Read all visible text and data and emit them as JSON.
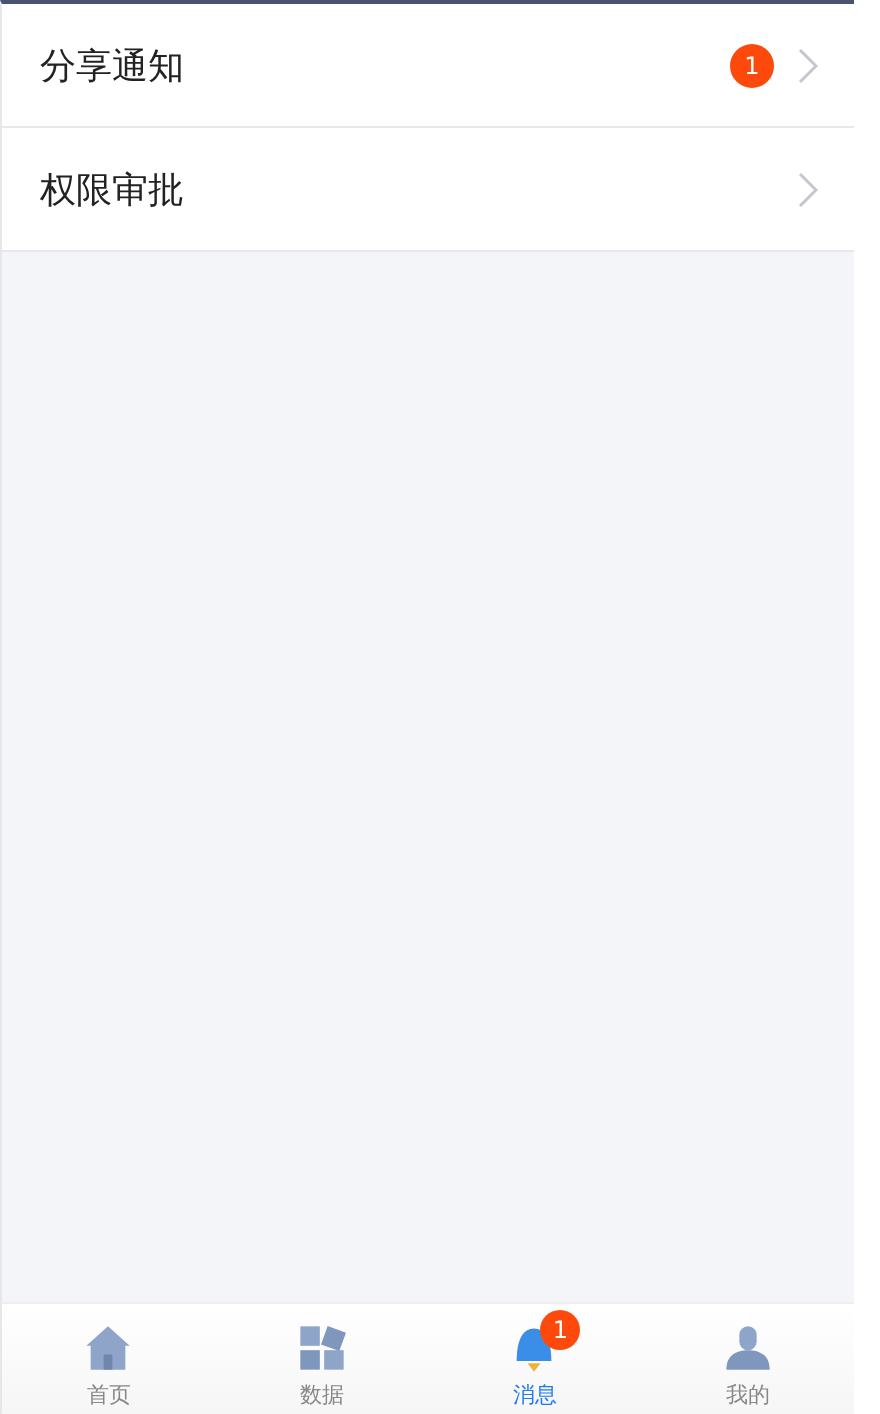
{
  "list": [
    {
      "label": "分享通知",
      "badge": "1"
    },
    {
      "label": "权限审批"
    }
  ],
  "tabbar": [
    {
      "kind": "home",
      "label": "首页",
      "selected": false
    },
    {
      "kind": "data",
      "label": "数据",
      "selected": false
    },
    {
      "kind": "message",
      "label": "消息",
      "selected": true,
      "badge": "1"
    },
    {
      "kind": "mine",
      "label": "我的",
      "selected": false
    }
  ]
}
